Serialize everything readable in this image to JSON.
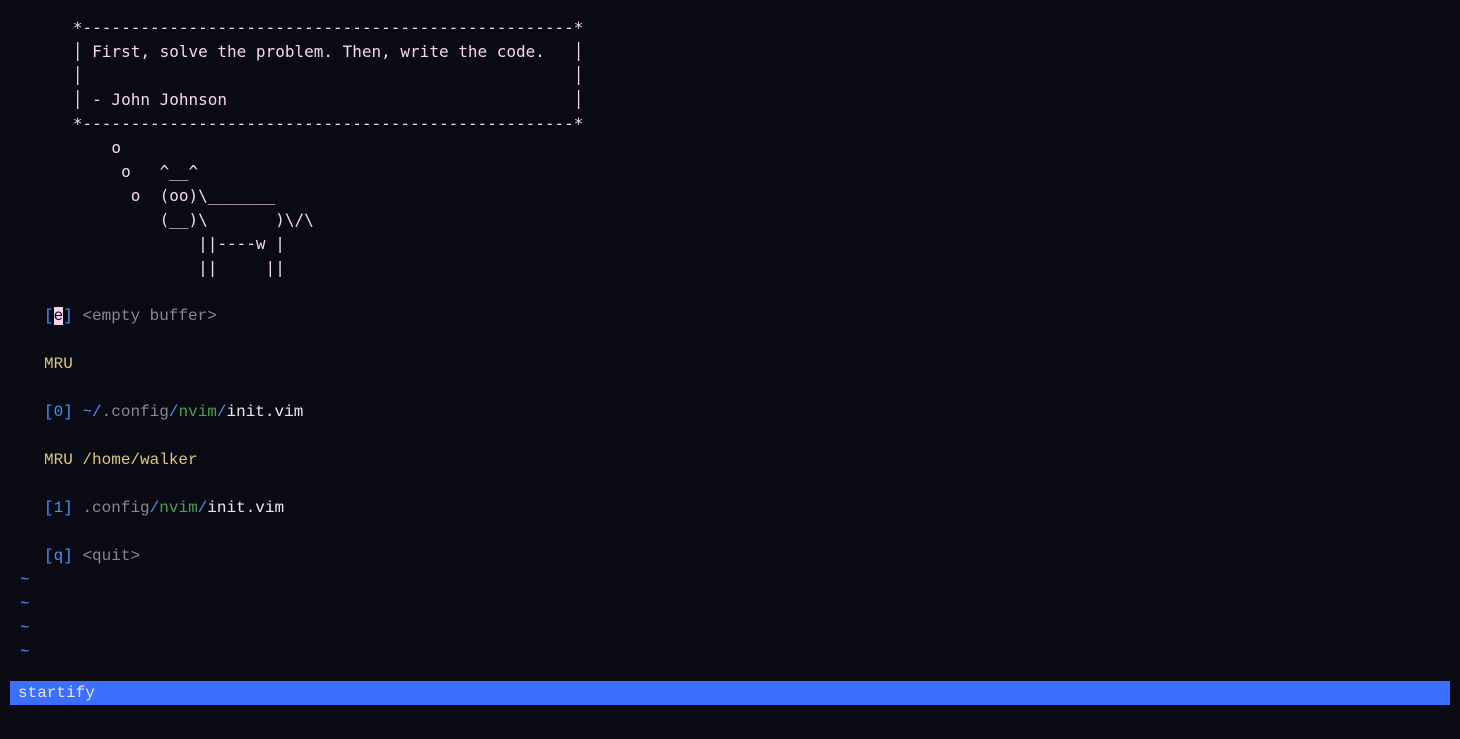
{
  "cowsay": {
    "lines": [
      "   *---------------------------------------------------*",
      "   │ First, solve the problem. Then, write the code.   │",
      "   │                                                   │",
      "   │ - John Johnson                                    │",
      "   *---------------------------------------------------*",
      "       o",
      "        o   ^__^",
      "         o  (oo)\\_______",
      "            (__)\\       )\\/\\",
      "                ||----w |",
      "                ||     ||"
    ]
  },
  "entries": {
    "empty": {
      "lb": "[",
      "key": "e",
      "rb": "]",
      "label": "<empty buffer>"
    },
    "mru_header": "MRU",
    "mru0": {
      "lb": "[",
      "key": "0",
      "rb": "]",
      "tilde": "~",
      "sep1": "/",
      "config": ".config",
      "sep2": "/",
      "nvim": "nvim",
      "sep3": "/",
      "file": "init.vim"
    },
    "mru_home_header": "MRU /home/walker",
    "mru1": {
      "lb": "[",
      "key": "1",
      "rb": "]",
      "config": ".config",
      "sep2": "/",
      "nvim": "nvim",
      "sep3": "/",
      "file": "init.vim"
    },
    "quit": {
      "lb": "[",
      "key": "q",
      "rb": "]",
      "label": "<quit>"
    }
  },
  "tilde": "~",
  "statusline": "startify"
}
